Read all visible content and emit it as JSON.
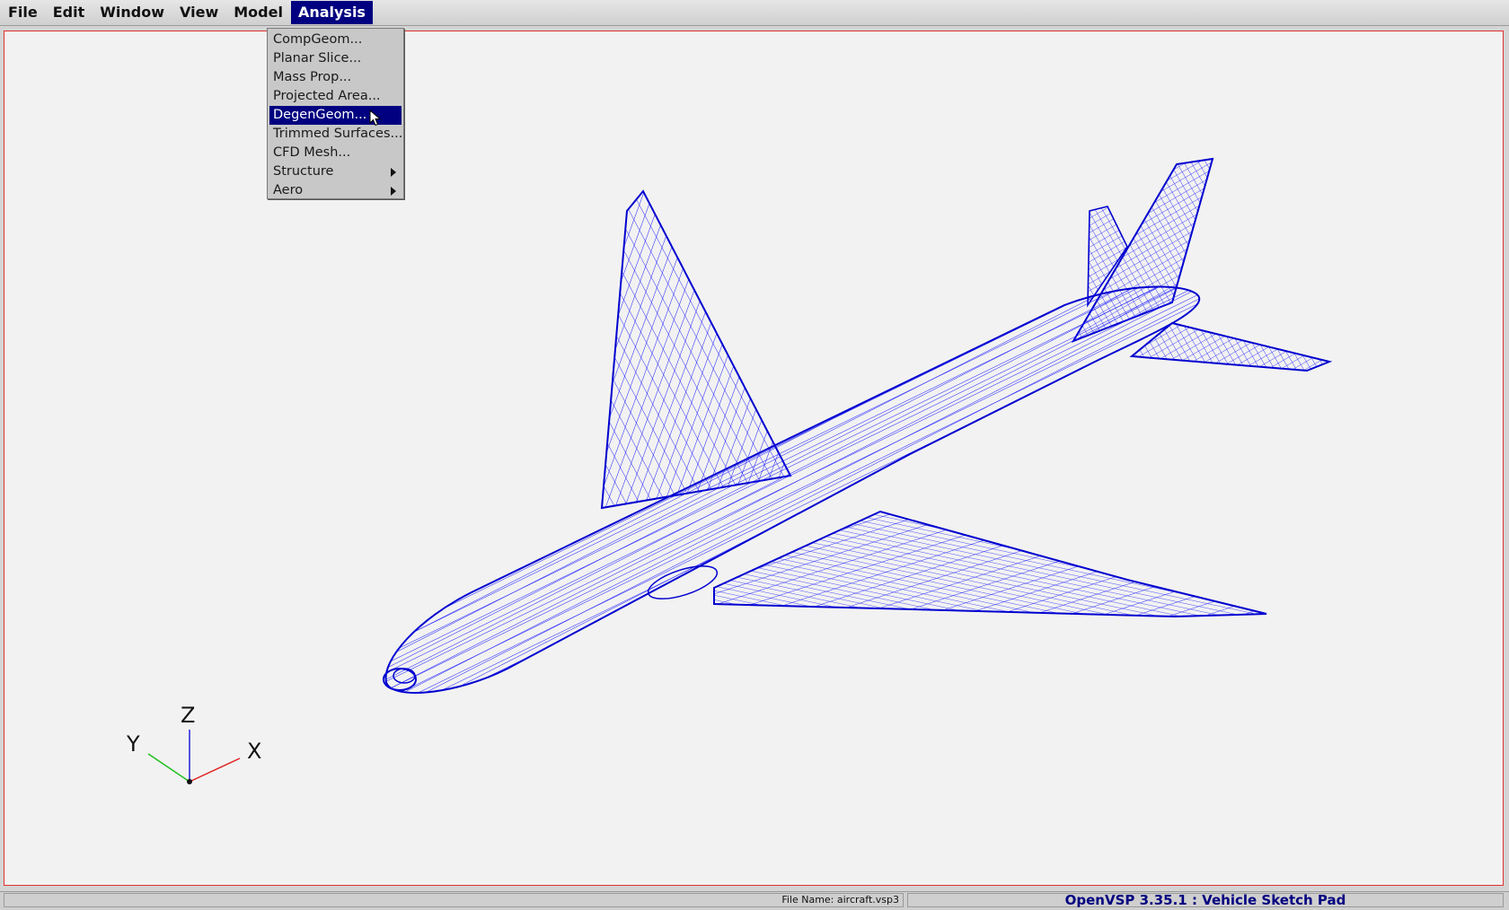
{
  "menubar": {
    "items": [
      {
        "label": "File"
      },
      {
        "label": "Edit"
      },
      {
        "label": "Window"
      },
      {
        "label": "View"
      },
      {
        "label": "Model"
      },
      {
        "label": "Analysis",
        "active": true
      }
    ]
  },
  "analysis_menu": {
    "items": [
      {
        "label": "CompGeom..."
      },
      {
        "label": "Planar Slice..."
      },
      {
        "label": "Mass Prop..."
      },
      {
        "label": "Projected Area..."
      },
      {
        "label": "DegenGeom...",
        "selected": true
      },
      {
        "label": "Trimmed Surfaces..."
      },
      {
        "label": "CFD Mesh..."
      },
      {
        "label": "Structure",
        "submenu": true
      },
      {
        "label": "Aero",
        "submenu": true
      }
    ]
  },
  "viewport": {
    "model": "aircraft wireframe",
    "wire_color": "#1a1aff",
    "border_color": "#e03030",
    "axes": {
      "x_label": "X",
      "y_label": "Y",
      "z_label": "Z",
      "x_color": "#e02020",
      "y_color": "#20c020",
      "z_color": "#2020e0"
    }
  },
  "statusbar": {
    "file_name": "File Name: aircraft.vsp3",
    "title": "OpenVSP 3.35.1 : Vehicle Sketch Pad"
  },
  "icons": {
    "cursor": "arrow-cursor-icon",
    "submenu": "triangle-right-icon"
  }
}
